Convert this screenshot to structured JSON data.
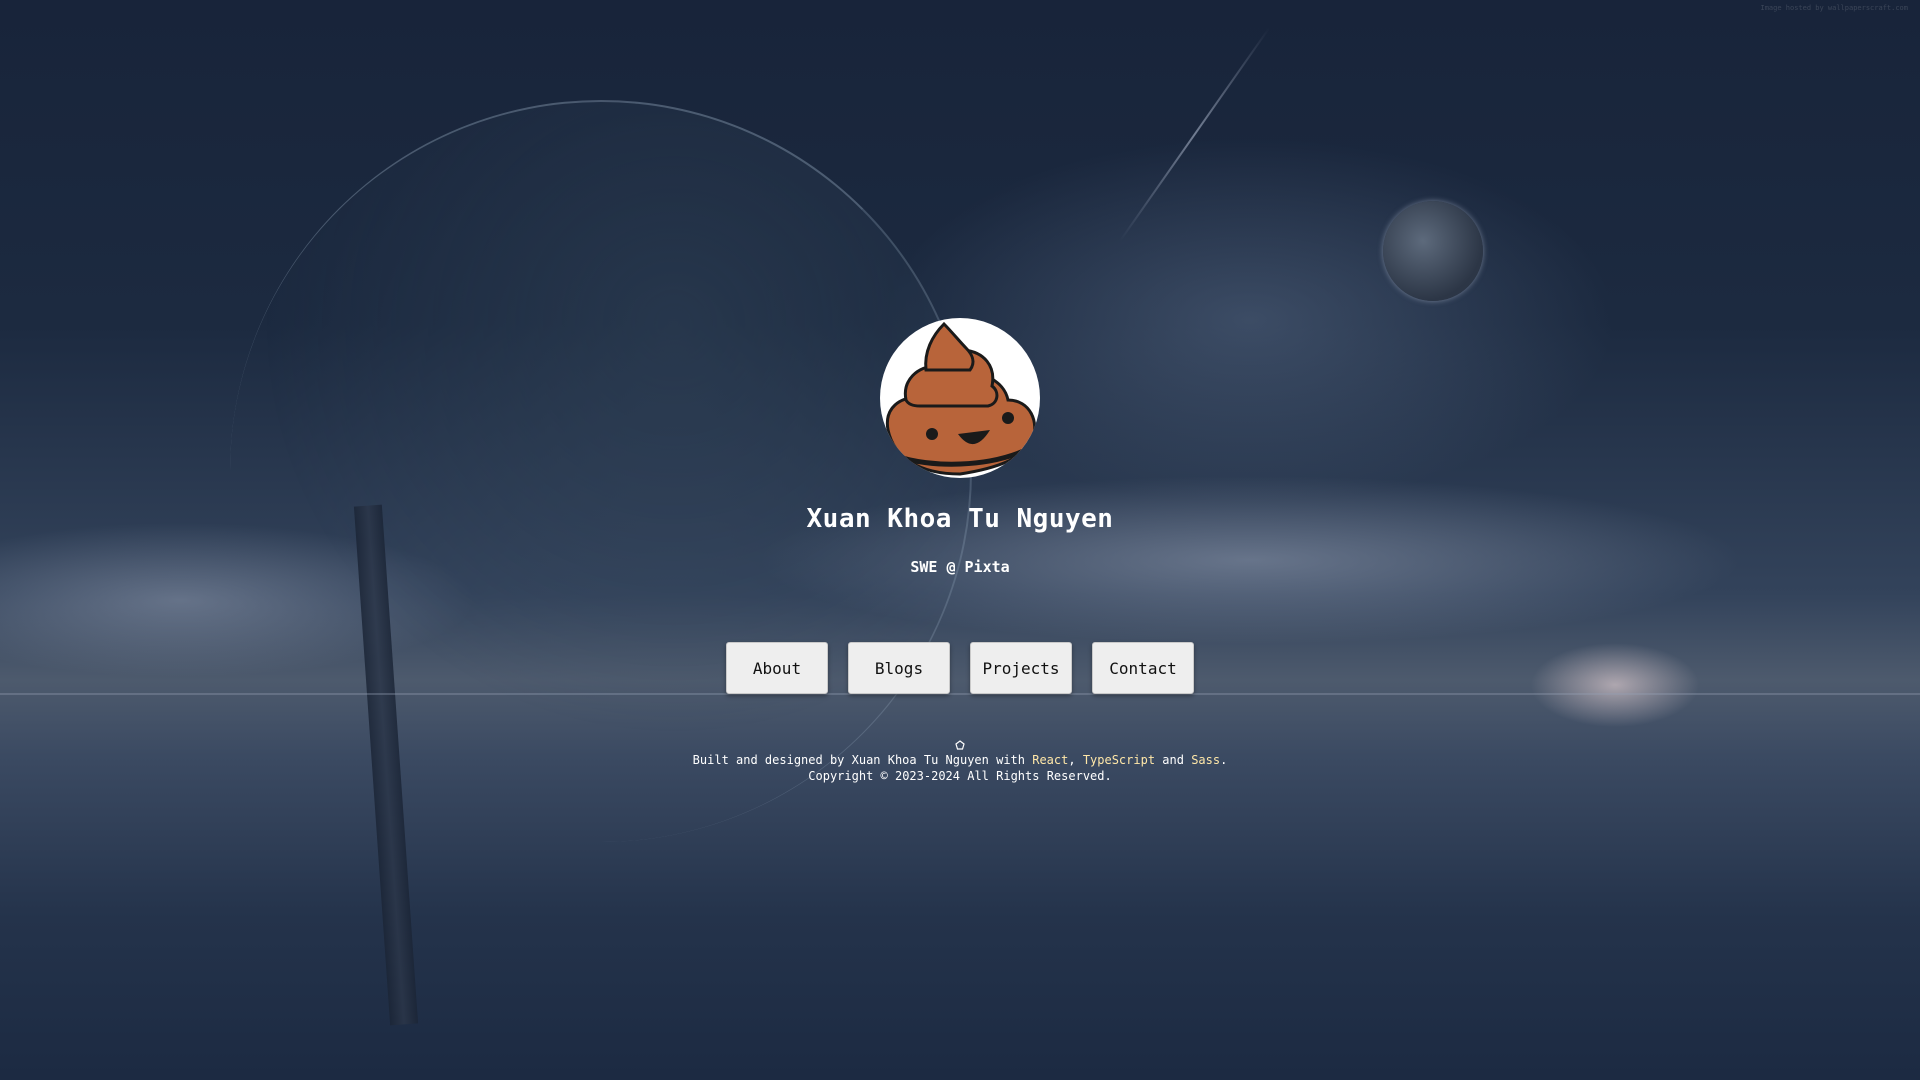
{
  "profile": {
    "name": "Xuan Khoa Tu Nguyen",
    "subtitle": "SWE @ Pixta",
    "avatar_icon": "poop-emoji-icon"
  },
  "nav": {
    "items": [
      {
        "label": "About"
      },
      {
        "label": "Blogs"
      },
      {
        "label": "Projects"
      },
      {
        "label": "Contact"
      }
    ]
  },
  "footer": {
    "built_prefix": "Built and designed by Xuan Khoa Tu Nguyen with ",
    "tech": [
      "React",
      "TypeScript",
      "Sass"
    ],
    "sep1": ", ",
    "sep2": " and ",
    "end": ".",
    "copyright": "Copyright © 2023-2024 All Rights Reserved.",
    "icon": "pentagon-icon"
  },
  "watermark": "Image hosted by wallpaperscraft.com",
  "colors": {
    "background": "#1c2a40",
    "button_bg": "#eeeeee",
    "avatar_brown": "#b8643a",
    "link": "#ffe7a8"
  }
}
